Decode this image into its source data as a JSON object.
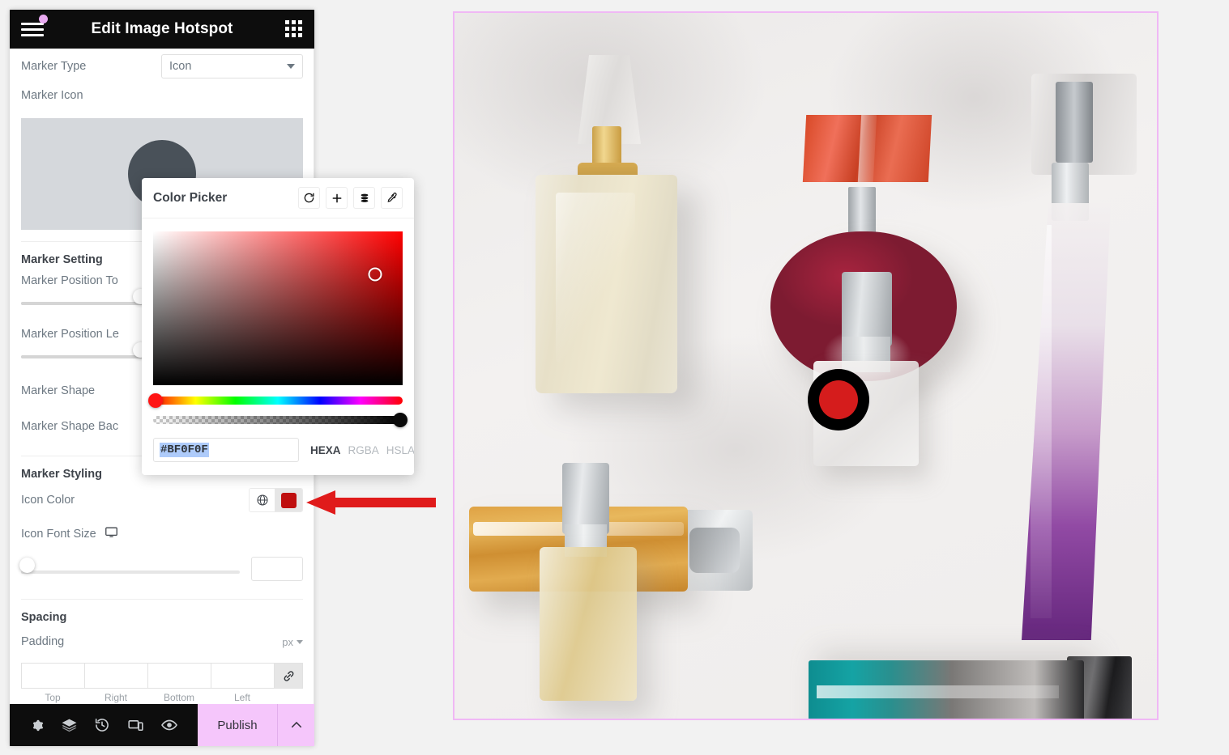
{
  "header": {
    "title": "Edit Image Hotspot",
    "menu_icon": "hamburger-icon",
    "grid_icon": "grid-apps-icon",
    "notification_dot": true
  },
  "panel": {
    "marker_type": {
      "label": "Marker Type",
      "value": "Icon"
    },
    "marker_icon": {
      "label": "Marker Icon"
    },
    "marker_setting": {
      "section_title": "Marker Setting",
      "position_top_label": "Marker Position To",
      "position_left_label": "Marker Position Le",
      "shape_label": "Marker Shape",
      "shape_background_label": "Marker Shape Bac"
    },
    "marker_styling": {
      "section_title": "Marker Styling",
      "icon_color_label": "Icon Color",
      "icon_color_value": "#BF0F0F",
      "icon_font_size_label": "Icon Font Size",
      "icon_font_size_value": "",
      "globe_icon": "globe-icon",
      "responsive_icon": "desktop-icon"
    },
    "spacing": {
      "section_title": "Spacing",
      "padding_label": "Padding",
      "unit": "px",
      "values": [
        "",
        "",
        "",
        ""
      ],
      "side_labels": [
        "Top",
        "Right",
        "Bottom",
        "Left"
      ],
      "link_icon": "link-icon"
    }
  },
  "color_picker": {
    "title": "Color Picker",
    "actions": [
      {
        "name": "reset-icon",
        "label": "Reset"
      },
      {
        "name": "add-icon",
        "label": "Add"
      },
      {
        "name": "swatches-icon",
        "label": "Swatches"
      },
      {
        "name": "eyedropper-icon",
        "label": "Eyedropper"
      }
    ],
    "hex_value": "#BF0F0F",
    "hex_selected": true,
    "formats": [
      {
        "label": "HEXA",
        "active": true
      },
      {
        "label": "RGBA",
        "active": false
      },
      {
        "label": "HSLA",
        "active": false
      }
    ],
    "hue_position_pct": 1,
    "alpha_position_pct": 99,
    "sv_cursor_x_pct": 89,
    "sv_cursor_y_pct": 28
  },
  "footer": {
    "tools": [
      {
        "name": "settings-gear-icon",
        "label": "Settings"
      },
      {
        "name": "layers-icon",
        "label": "Navigator"
      },
      {
        "name": "history-icon",
        "label": "History"
      },
      {
        "name": "responsive-mode-icon",
        "label": "Responsive Mode"
      },
      {
        "name": "preview-eye-icon",
        "label": "Preview Changes"
      }
    ],
    "publish_label": "Publish",
    "publish_color": "#f5c6fb",
    "publish_arrow_icon": "chevron-up-icon"
  },
  "canvas": {
    "border_color": "#f0b8f5",
    "hotspot_marker": {
      "outer_color": "#000000",
      "inner_color": "#d51c1c"
    },
    "annotation_arrow": {
      "color": "#e01b1b",
      "direction": "left"
    }
  }
}
